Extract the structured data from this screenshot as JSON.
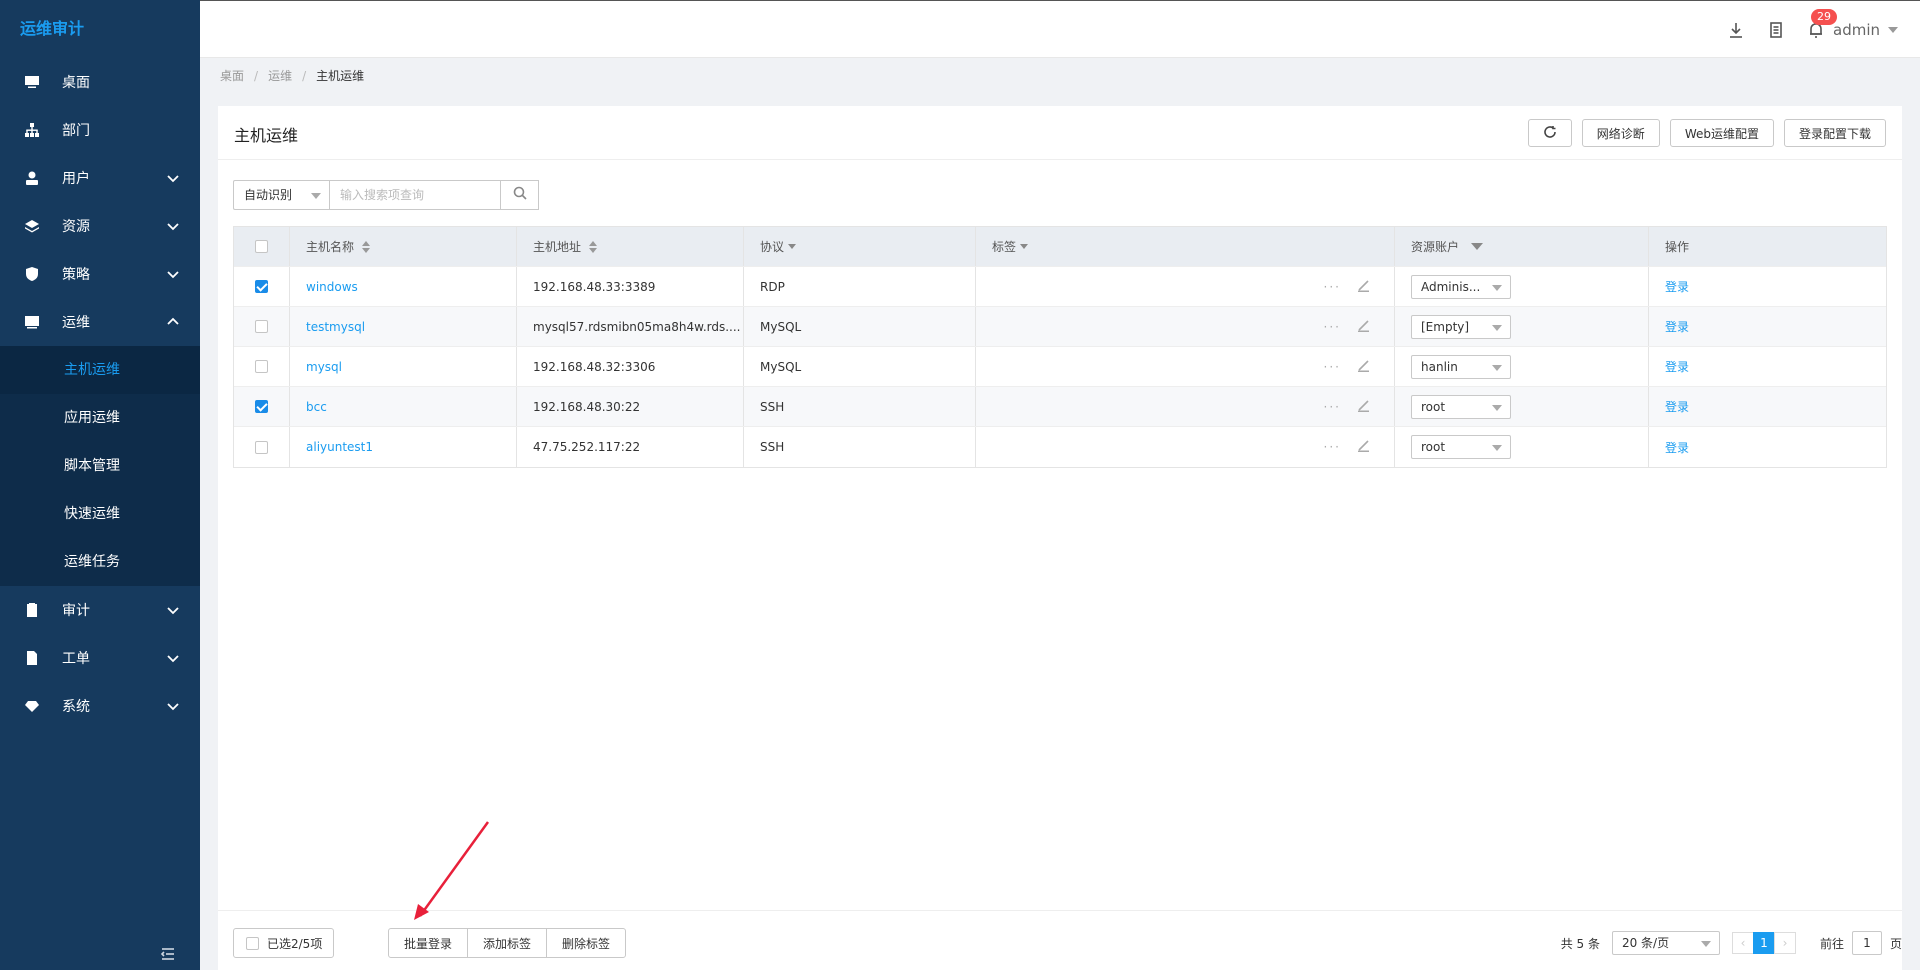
{
  "app": {
    "title": "运维审计"
  },
  "sidebar": {
    "items": [
      {
        "label": "桌面",
        "icon": "desktop-icon",
        "expandable": false
      },
      {
        "label": "部门",
        "icon": "org-icon",
        "expandable": false
      },
      {
        "label": "用户",
        "icon": "user-icon",
        "expandable": true
      },
      {
        "label": "资源",
        "icon": "layers-icon",
        "expandable": true
      },
      {
        "label": "策略",
        "icon": "shield-icon",
        "expandable": true
      },
      {
        "label": "运维",
        "icon": "monitor-icon",
        "expandable": true,
        "expanded": true
      },
      {
        "label": "审计",
        "icon": "clipboard-icon",
        "expandable": true
      },
      {
        "label": "工单",
        "icon": "document-icon",
        "expandable": true
      },
      {
        "label": "系统",
        "icon": "diamond-icon",
        "expandable": true
      }
    ],
    "submenu": [
      "主机运维",
      "应用运维",
      "脚本管理",
      "快速运维",
      "运维任务"
    ],
    "active_sub": "主机运维"
  },
  "header": {
    "notification_count": "29",
    "user": "admin"
  },
  "breadcrumb": [
    "桌面",
    "运维",
    "主机运维"
  ],
  "page": {
    "title": "主机运维",
    "actions": {
      "refresh": "refresh-icon",
      "network": "网络诊断",
      "web_config": "Web运维配置",
      "login_download": "登录配置下载"
    }
  },
  "search": {
    "mode": "自动识别",
    "placeholder": "输入搜索项查询"
  },
  "table": {
    "headers": {
      "name": "主机名称",
      "addr": "主机地址",
      "proto": "协议",
      "tag": "标签",
      "acct": "资源账户",
      "op": "操作"
    },
    "rows": [
      {
        "checked": true,
        "name": "windows",
        "addr": "192.168.48.33:3389",
        "proto": "RDP",
        "acct": "Adminis...",
        "op": "登录"
      },
      {
        "checked": false,
        "name": "testmysql",
        "addr": "mysql57.rdsmibn05ma8h4w.rds....",
        "proto": "MySQL",
        "acct": "[Empty]",
        "op": "登录"
      },
      {
        "checked": false,
        "name": "mysql",
        "addr": "192.168.48.32:3306",
        "proto": "MySQL",
        "acct": "hanlin",
        "op": "登录"
      },
      {
        "checked": true,
        "name": "bcc",
        "addr": "192.168.48.30:22",
        "proto": "SSH",
        "acct": "root",
        "op": "登录"
      },
      {
        "checked": false,
        "name": "aliyuntest1",
        "addr": "47.75.252.117:22",
        "proto": "SSH",
        "acct": "root",
        "op": "登录"
      }
    ]
  },
  "footer": {
    "selected": "已选2/5项",
    "batch_login": "批量登录",
    "add_tag": "添加标签",
    "remove_tag": "删除标签",
    "total": "共 5 条",
    "page_size": "20 条/页",
    "current_page": "1",
    "goto_label": "前往",
    "goto_value": "1",
    "page_suffix": "页"
  },
  "colors": {
    "sidebar": "#163a5e",
    "accent": "#1a9cf0",
    "badge": "#f5504f",
    "annotation": "#e8203a"
  }
}
